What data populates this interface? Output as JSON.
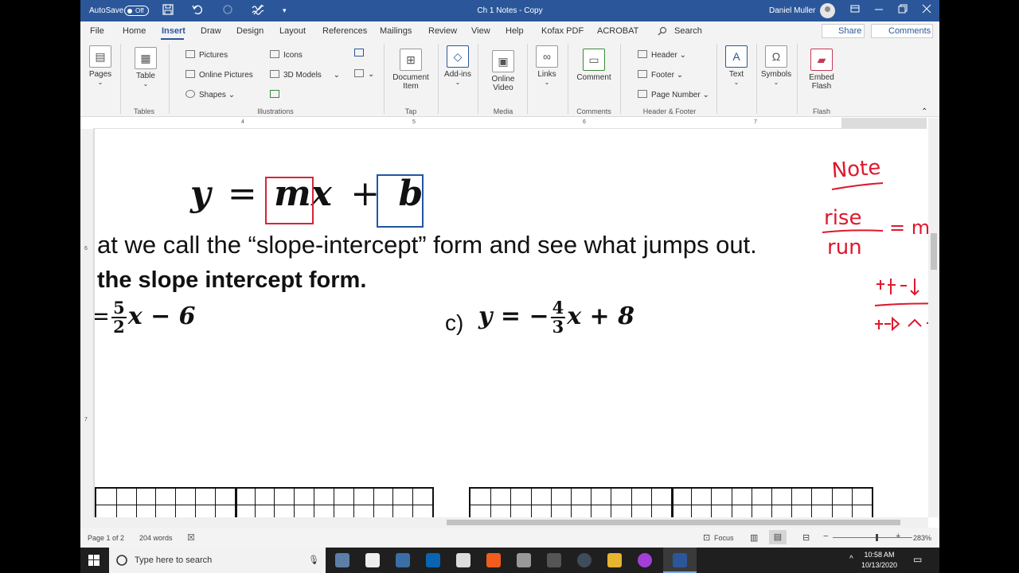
{
  "titlebar": {
    "autosave_label": "AutoSave",
    "autosave_state": "Off",
    "document_title": "Ch 1 Notes  -  Copy",
    "user_name": "Daniel Muller"
  },
  "tabs": [
    "File",
    "Home",
    "Insert",
    "Draw",
    "Design",
    "Layout",
    "References",
    "Mailings",
    "Review",
    "View",
    "Help",
    "Kofax PDF",
    "ACROBAT"
  ],
  "active_tab": "Insert",
  "search_label": "Search",
  "share_label": "Share",
  "comments_label": "Comments",
  "ribbon": {
    "pages": "Pages",
    "table": "Table",
    "tables_group": "Tables",
    "pictures": "Pictures",
    "online_pictures": "Online Pictures",
    "shapes": "Shapes",
    "icons": "Icons",
    "models_3d": "3D Models",
    "illustrations_group": "Illustrations",
    "document_item": "Document Item",
    "tap_group": "Tap",
    "addins": "Add-ins",
    "online_video": "Online Video",
    "media_group": "Media",
    "links": "Links",
    "comment": "Comment",
    "comments_group": "Comments",
    "header": "Header",
    "footer": "Footer",
    "page_number": "Page Number",
    "header_footer_group": "Header & Footer",
    "text": "Text",
    "symbols": "Symbols",
    "embed_flash": "Embed Flash",
    "flash_group": "Flash"
  },
  "ruler_numbers": [
    "4",
    "5",
    "6",
    "7"
  ],
  "vruler_numbers": [
    "6",
    "7"
  ],
  "document": {
    "equation": "y = mx + b",
    "eq_y": "y",
    "eq_eq": "=",
    "eq_m": "m",
    "eq_x": "x",
    "eq_plus": "+",
    "eq_b": "b",
    "line1": "at we call the “slope-intercept” form and see what jumps out.",
    "line2": "the slope intercept form.",
    "eq_b_left": "=",
    "eq_b_num": "5",
    "eq_b_den": "2",
    "eq_b_rest": "x − 6",
    "eq_c_label": "c)",
    "eq_c_left": "y = −",
    "eq_c_num": "4",
    "eq_c_den": "3",
    "eq_c_rest": "x + 8"
  },
  "ink_notes": {
    "title": "Note",
    "rise": "rise",
    "run": "run",
    "eq_m": "= m"
  },
  "status": {
    "page": "Page 1 of 2",
    "words": "204 words",
    "focus": "Focus",
    "zoom": "283%"
  },
  "taskbar": {
    "search_placeholder": "Type here to search",
    "time": "10:58 AM",
    "date": "10/13/2020"
  },
  "colors": {
    "word_blue": "#2b579a",
    "red_box": "#d5253a",
    "blue_box": "#1f58a0",
    "ink_red": "#e0182d"
  }
}
